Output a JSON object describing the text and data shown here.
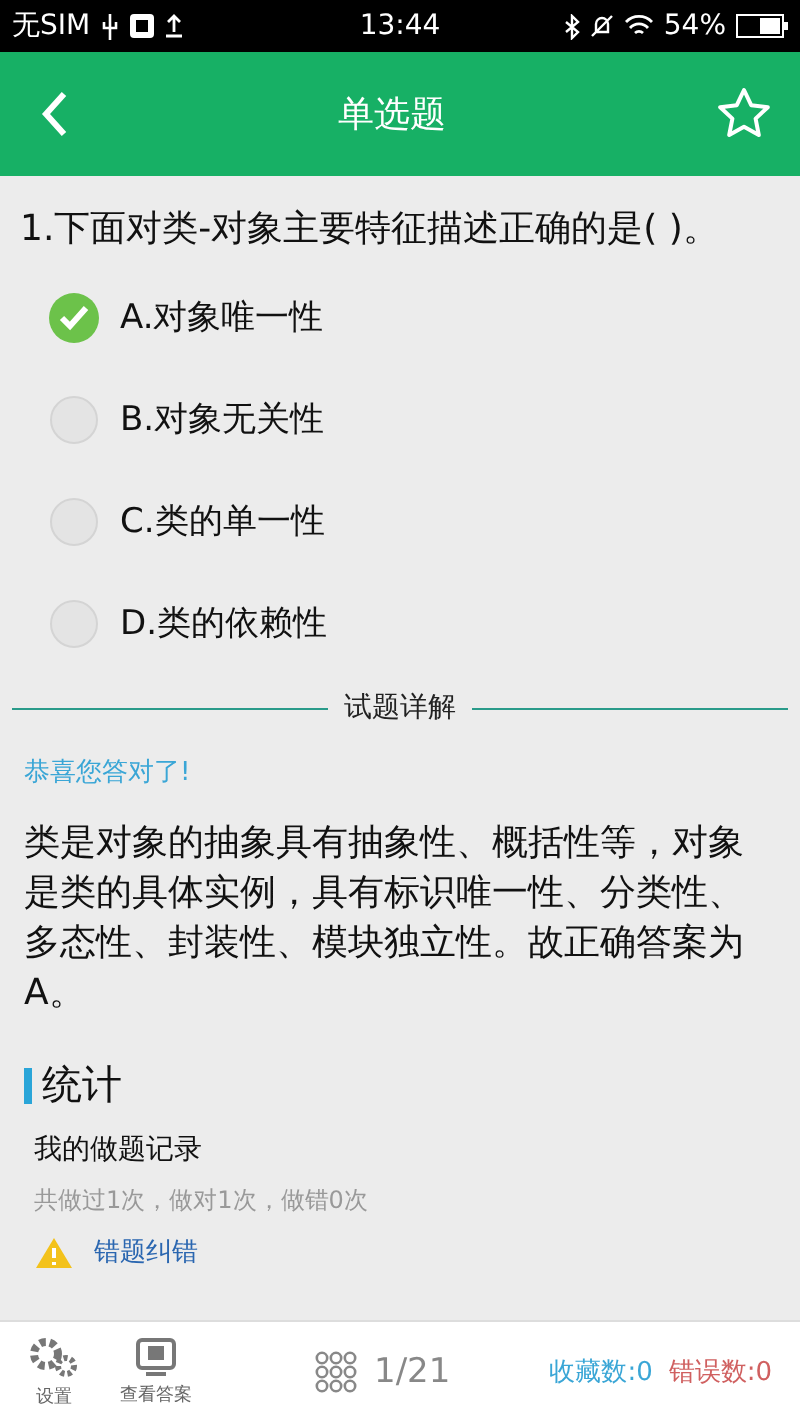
{
  "status_bar": {
    "carrier": "无SIM",
    "time": "13:44",
    "battery": "54%"
  },
  "header": {
    "title": "单选题",
    "favorited": false
  },
  "question": {
    "text": "1.下面对类-对象主要特征描述正确的是( )。",
    "options": [
      {
        "label": "A.对象唯一性",
        "selected": true
      },
      {
        "label": "B.对象无关性",
        "selected": false
      },
      {
        "label": "C.类的单一性",
        "selected": false
      },
      {
        "label": "D.类的依赖性",
        "selected": false
      }
    ]
  },
  "explanation": {
    "heading": "试题详解",
    "result": "恭喜您答对了!",
    "text": "类是对象的抽象具有抽象性、概括性等，对象是类的具体实例，具有标识唯一性、分类性、多态性、封装性、模块独立性。故正确答案为A。"
  },
  "statistics": {
    "heading": "统计",
    "record_title": "我的做题记录",
    "record_text": "共做过1次，做对1次，做错0次",
    "report_link": "错题纠错"
  },
  "bottom_bar": {
    "settings": "设置",
    "view_answer": "查看答案",
    "progress": "1/21",
    "favorites": "收藏数:0",
    "errors": "错误数:0"
  }
}
